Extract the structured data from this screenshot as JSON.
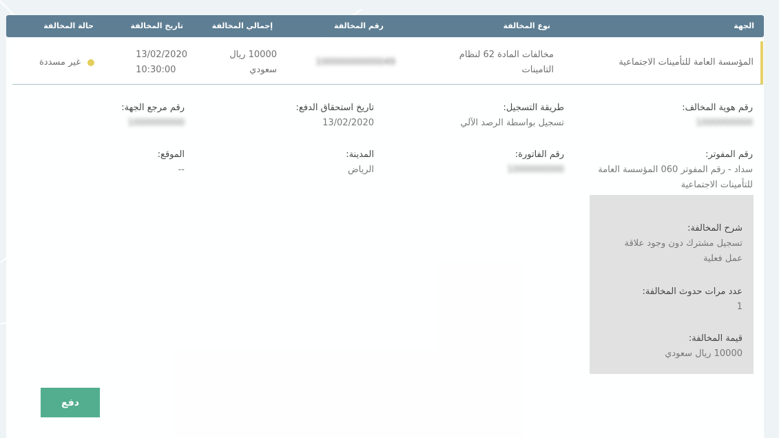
{
  "table": {
    "headers": {
      "authority": "الجهة",
      "violation_type": "نوع المخالفة",
      "violation_number": "رقم المخالفة",
      "violation_total": "إجمالي المخالفة",
      "violation_date": "تاريخ المخالفة",
      "violation_status": "حالة المخالفة"
    },
    "row": {
      "authority": "المؤسسة العامة للتأمينات الاجتماعية",
      "violation_type": "مخالفات المادة 62 لنظام التامينات",
      "violation_number": "10000000000049",
      "violation_total": "10000 ريال سعودي",
      "violation_date_line1": "13/02/2020",
      "violation_date_line2": "10:30:00",
      "status": "غير مسددة",
      "status_color": "#e3cf5b"
    }
  },
  "details": {
    "violator_id": {
      "label": "رقم هوية المخالف:",
      "value": "1000000000"
    },
    "registration_method": {
      "label": "طريقة التسجيل:",
      "value": "تسجيل بواسطة الرصد الآلي"
    },
    "payment_due_date": {
      "label": "تاريخ استحقاق الدفع:",
      "value": "13/02/2020"
    },
    "authority_reference": {
      "label": "رقم مرجع الجهة:",
      "value": "1000000000"
    },
    "biller_number": {
      "label": "رقم المفوتر:",
      "value": "سداد - رقم المفوتر 060 المؤسسة العامة للتأمينات الاجتماعية"
    },
    "invoice_number": {
      "label": "رقم الفاتورة:",
      "value": "1000000000"
    },
    "city": {
      "label": "المدينة:",
      "value": "الرياض"
    },
    "location": {
      "label": "الموقع:",
      "value": "--"
    }
  },
  "violation_box": {
    "description": {
      "label": "شرح المخالفة:",
      "value": "تسجيل مشترك دون وجود علاقة عمل فعلية"
    },
    "occurrences": {
      "label": "عدد مرات حدوث المخالفة:",
      "value": "1"
    },
    "amount": {
      "label": "قيمة المخالفة:",
      "value": "10000 ريال سعودي"
    }
  },
  "actions": {
    "pay_label": "دفع"
  },
  "colors": {
    "header_bg": "#5d7e93",
    "accent_green": "#52ae8e",
    "status_yellow": "#e3cf5b"
  }
}
